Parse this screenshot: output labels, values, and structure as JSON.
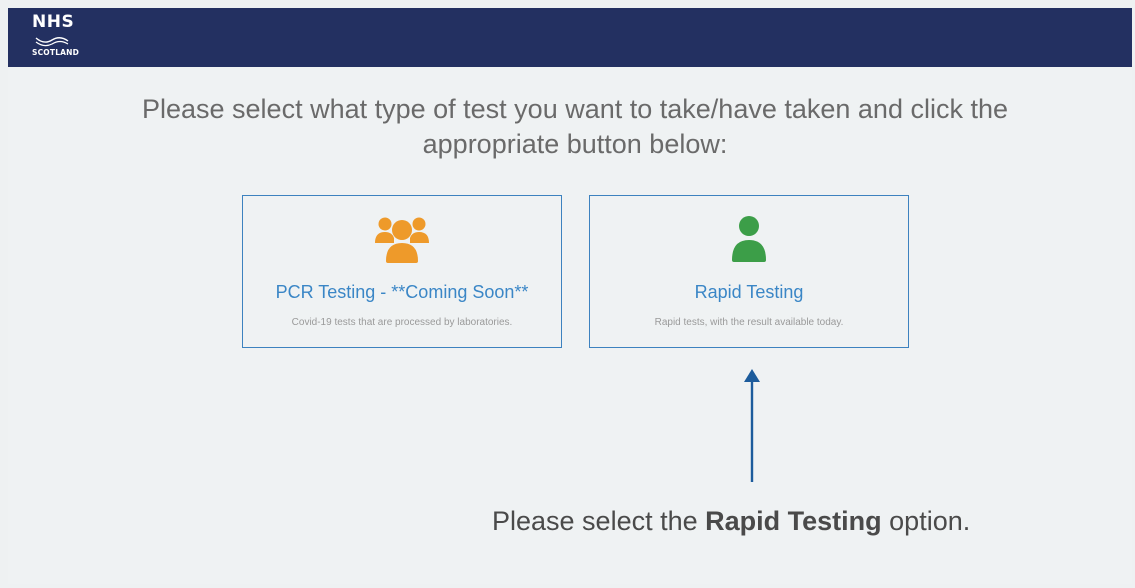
{
  "header": {
    "logo_nhs": "NHS",
    "logo_scotland": "SCOTLAND",
    "background_color": "#233061"
  },
  "prompt": {
    "text": "Please select what type of test you want to take/have taken and click the appropriate button below:"
  },
  "options": [
    {
      "title": "PCR Testing - **Coming Soon**",
      "description": "Covid-19 tests that are processed by laboratories.",
      "icon": "group-icon",
      "icon_color": "#ee9a2a"
    },
    {
      "title": "Rapid Testing",
      "description": "Rapid tests, with the result available today.",
      "icon": "user-icon",
      "icon_color": "#3c9e48"
    }
  ],
  "annotation": {
    "prefix": "Please select the ",
    "highlight": "Rapid Testing",
    "suffix": " option.",
    "arrow_color": "#1d5c9c"
  }
}
